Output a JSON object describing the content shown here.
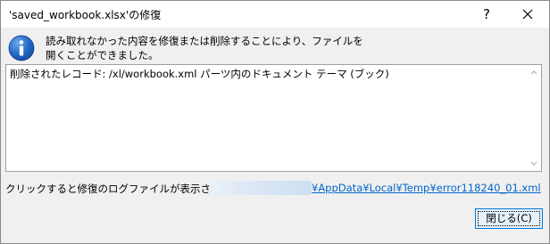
{
  "window": {
    "title": "'saved_workbook.xlsx'の修復",
    "help_label": "?",
    "close_icon": "close-icon"
  },
  "message": {
    "icon": "info-icon",
    "text": "読み取れなかった内容を修復または削除することにより、ファイルを開くことができました。"
  },
  "details": {
    "text": "削除されたレコード: /xl/workbook.xml パーツ内のドキュメント テーマ (ブック)"
  },
  "log": {
    "label": "クリックすると修復のログファイルが表示されます:",
    "link": "¥AppData¥Local¥Temp¥error118240_01.xml"
  },
  "buttons": {
    "close_label": "閉じる(C)"
  }
}
